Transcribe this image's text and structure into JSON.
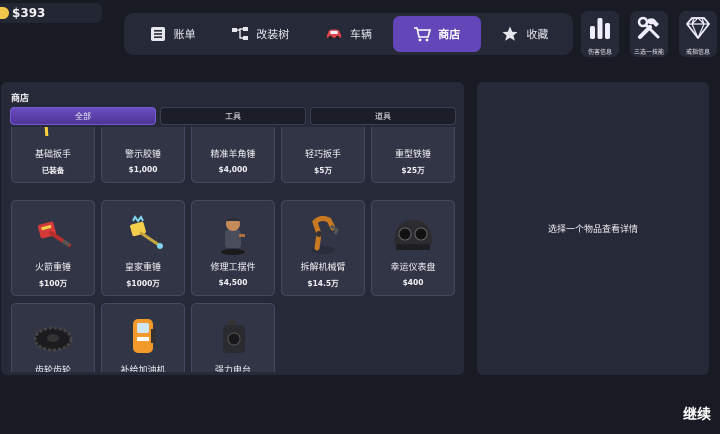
{
  "money": {
    "value": "$393",
    "icon": "coin-icon"
  },
  "nav": [
    {
      "label": "账单",
      "icon": "ledger-icon",
      "active": false
    },
    {
      "label": "改装树",
      "icon": "tree-icon",
      "active": false
    },
    {
      "label": "车辆",
      "icon": "car-icon",
      "active": false
    },
    {
      "label": "商店",
      "icon": "cart-icon",
      "active": true
    },
    {
      "label": "收藏",
      "icon": "star-icon",
      "active": false
    }
  ],
  "side_buttons": [
    {
      "label": "伤害信息",
      "icon": "bar-chart-icon"
    },
    {
      "label": "三选一技能",
      "icon": "tools-icon"
    },
    {
      "label": "戒指信息",
      "icon": "diamond-icon"
    }
  ],
  "shop": {
    "title": "商店",
    "tabs": [
      {
        "label": "全部",
        "active": true
      },
      {
        "label": "工具",
        "active": false
      },
      {
        "label": "道具",
        "active": false
      }
    ],
    "items": [
      {
        "name": "基础扳手",
        "price": "已装备",
        "icon": "wrench-icon"
      },
      {
        "name": "警示胶锤",
        "price": "$1,000",
        "icon": "mallet-icon"
      },
      {
        "name": "精准羊角锤",
        "price": "$4,000",
        "icon": "claw-hammer-icon"
      },
      {
        "name": "轻巧扳手",
        "price": "$5万",
        "icon": "light-wrench-icon"
      },
      {
        "name": "重型铁锤",
        "price": "$25万",
        "icon": "heavy-hammer-icon"
      },
      {
        "name": "火箭重锤",
        "price": "$100万",
        "icon": "rocket-hammer-icon"
      },
      {
        "name": "皇家重锤",
        "price": "$1000万",
        "icon": "royal-hammer-icon"
      },
      {
        "name": "修理工摆件",
        "price": "$4,500",
        "icon": "mechanic-figure-icon"
      },
      {
        "name": "拆解机械臂",
        "price": "$14.5万",
        "icon": "robot-arm-icon"
      },
      {
        "name": "幸运仪表盘",
        "price": "$400",
        "icon": "gauge-icon"
      },
      {
        "name": "齿轮齿轮",
        "price": "",
        "icon": "gear-icon"
      },
      {
        "name": "补给加油机",
        "price": "",
        "icon": "fuel-pump-icon"
      },
      {
        "name": "强力电台",
        "price": "",
        "icon": "radio-icon"
      }
    ]
  },
  "detail": {
    "placeholder": "选择一个物品查看详情"
  },
  "continue_label": "继续",
  "colors": {
    "accent": "#6346b8",
    "panel": "#262938",
    "card": "#323546",
    "background": "#181a24"
  }
}
